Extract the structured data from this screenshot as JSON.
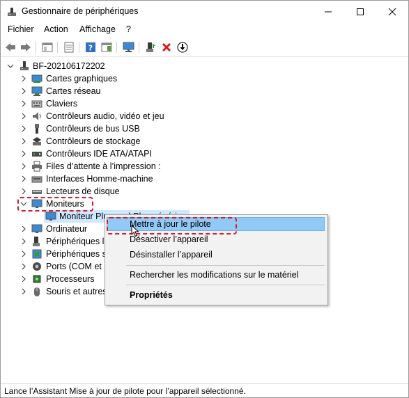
{
  "window": {
    "title": "Gestionnaire de périphériques",
    "minimize": "minimize",
    "maximize": "maximize",
    "close": "close"
  },
  "menu": [
    "Fichier",
    "Action",
    "Affichage",
    "?"
  ],
  "tree": {
    "root": "BF-20210617220​2",
    "items": [
      "Cartes graphiques",
      "Cartes réseau",
      "Claviers",
      "Contrôleurs audio, vidéo et jeu",
      "Contrôleurs de bus USB",
      "Contrôleurs de stockage",
      "Contrôleurs IDE ATA/ATAPI",
      "Files d’attente à l’impression :",
      "Interfaces Homme-machine",
      "Lecteurs de disque",
      "Moniteurs",
      "Moniteur Plug-and-Play générique",
      "Ordinateur",
      "Périphériques logiciels",
      "Périphériques système",
      "Ports (COM et LPT)",
      "Processeurs",
      "Souris et autres périphériques de pointage"
    ]
  },
  "context_menu": {
    "update": "Mettre à jour le pilote",
    "disable": "Désactiver l’appareil",
    "uninstall": "Désinstaller l’appareil",
    "scan": "Rechercher les modifications sur le matériel",
    "properties": "Propriétés"
  },
  "status": "Lance l’Assistant Mise à jour de pilote pour l’appareil sélectionné.",
  "colors": {
    "highlight": "#cde8ff",
    "menu_highlight": "#91c9f7",
    "annotation": "#d81b2a"
  }
}
